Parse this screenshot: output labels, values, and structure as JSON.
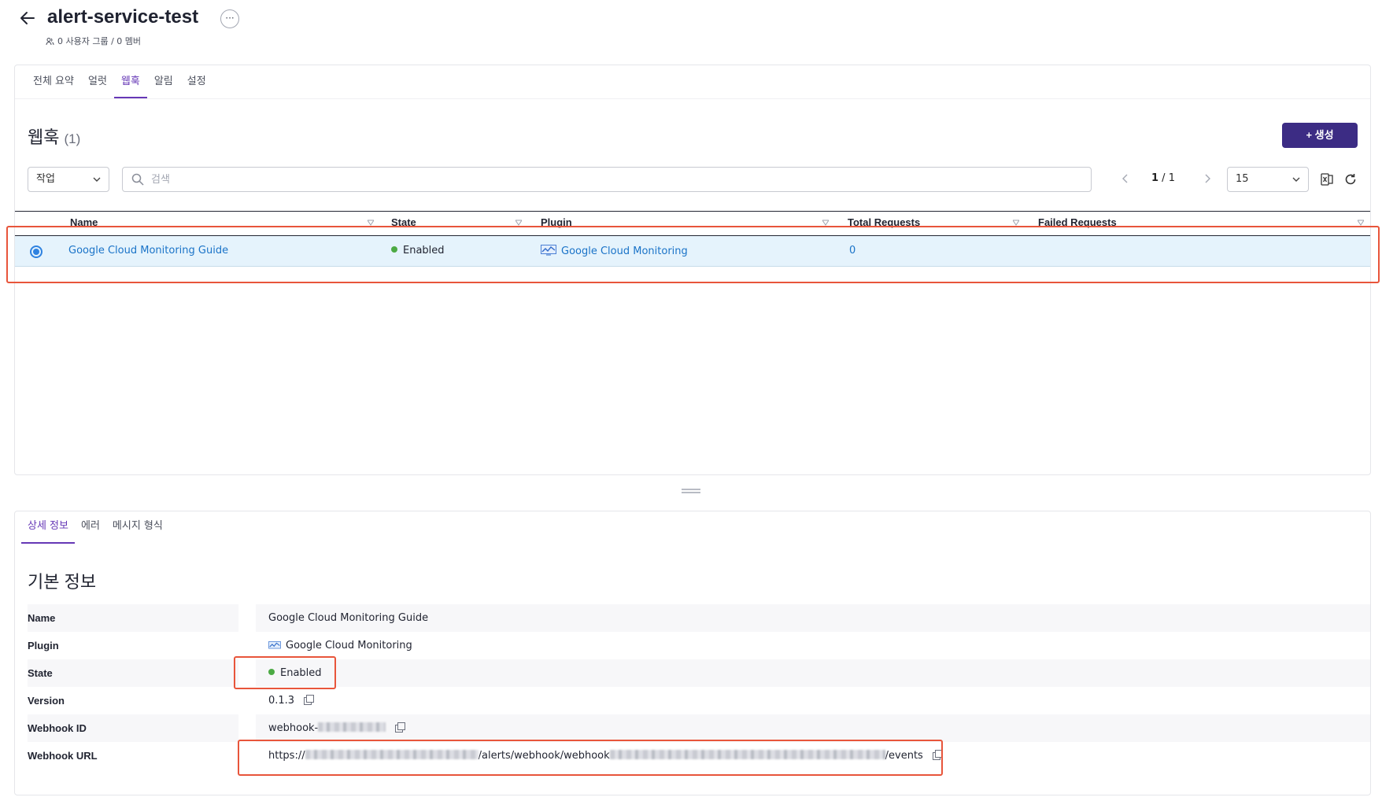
{
  "header": {
    "title": "alert-service-test",
    "more_label": "···",
    "meta": "0 사용자 그룹 / 0 멤버"
  },
  "tabs": [
    {
      "label": "전체 요약",
      "active": false
    },
    {
      "label": "얼럿",
      "active": false
    },
    {
      "label": "웹훅",
      "active": true
    },
    {
      "label": "알림",
      "active": false
    },
    {
      "label": "설정",
      "active": false
    }
  ],
  "section": {
    "title": "웹훅",
    "count": "(1)",
    "create_label": "+ 생성"
  },
  "toolbar": {
    "action_label": "작업",
    "search_placeholder": "검색",
    "pager_current": "1",
    "pager_sep": " / ",
    "pager_total": "1",
    "page_size": "15"
  },
  "table": {
    "columns": [
      "Name",
      "State",
      "Plugin",
      "Total Requests",
      "Failed Requests"
    ],
    "rows": [
      {
        "name": "Google Cloud Monitoring Guide",
        "state": "Enabled",
        "plugin": "Google Cloud Monitoring",
        "total_requests": "0",
        "failed_requests": ""
      }
    ]
  },
  "detail_tabs": [
    {
      "label": "상세 정보",
      "active": true
    },
    {
      "label": "에러",
      "active": false
    },
    {
      "label": "메시지 형식",
      "active": false
    }
  ],
  "detail": {
    "title": "기본 정보",
    "rows": [
      {
        "key": "Name",
        "value": "Google Cloud Monitoring Guide"
      },
      {
        "key": "Plugin",
        "value": "Google Cloud Monitoring"
      },
      {
        "key": "State",
        "value": "Enabled"
      },
      {
        "key": "Version",
        "value": "0.1.3"
      },
      {
        "key": "Webhook ID",
        "value": "webhook-"
      },
      {
        "key": "Webhook URL",
        "value_prefix": "https://",
        "value_mid": "/alerts/webhook/webhook",
        "value_suffix": "/events"
      }
    ]
  },
  "colors": {
    "accent": "#6638b6",
    "primary_button": "#3c2c84",
    "link": "#1a73c8",
    "enabled": "#4caa44",
    "highlight": "#e8553b",
    "selected_row": "#e5f3fc"
  }
}
